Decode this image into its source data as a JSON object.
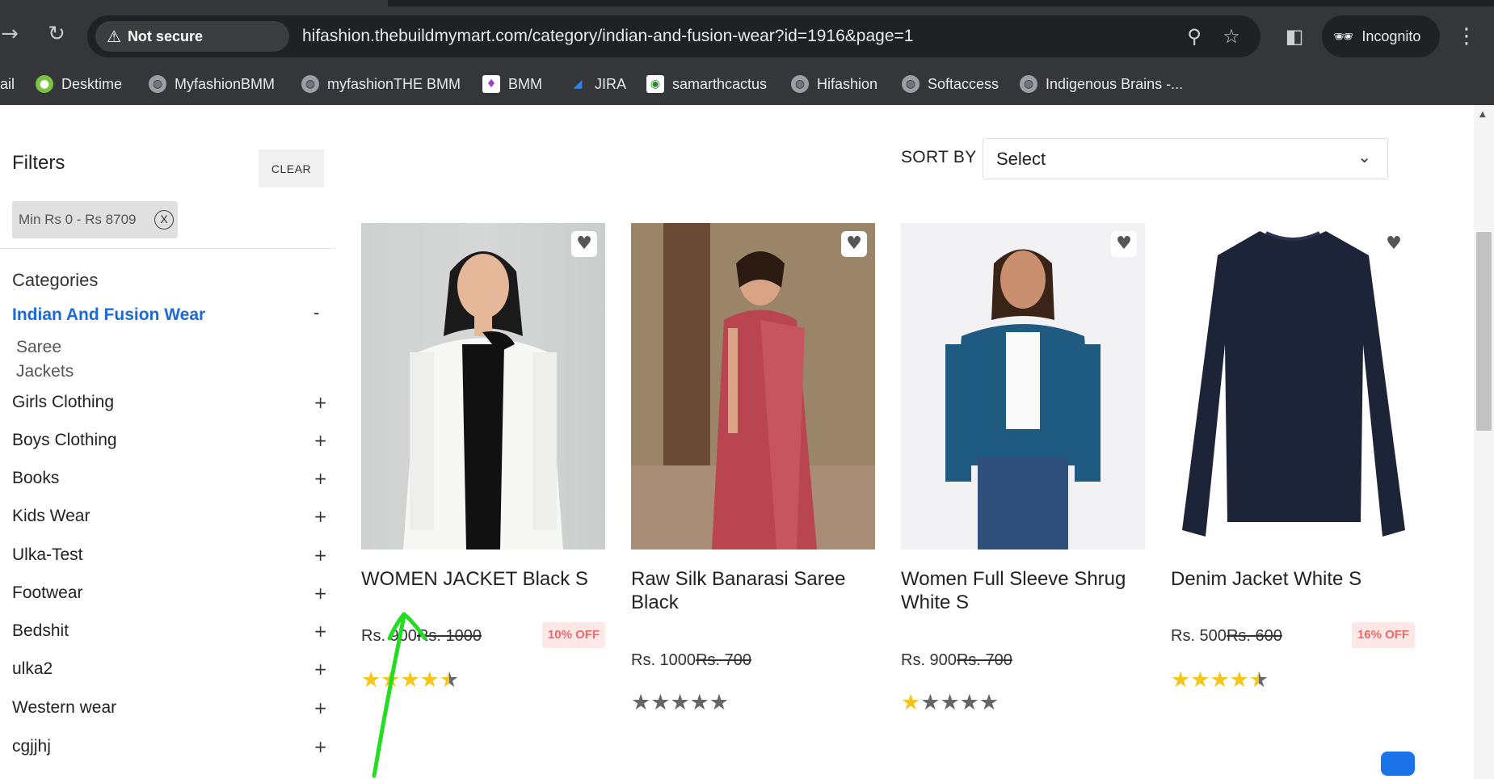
{
  "browser": {
    "security_label": "Not secure",
    "url": "hifashion.thebuildmymart.com/category/indian-and-fusion-wear?id=1916&page=1",
    "profile_label": "Incognito",
    "bookmarks": [
      {
        "label": "ail"
      },
      {
        "label": "Desktime"
      },
      {
        "label": "MyfashionBMM"
      },
      {
        "label": "myfashionTHE BMM"
      },
      {
        "label": "BMM"
      },
      {
        "label": "JIRA"
      },
      {
        "label": "samarthcactus"
      },
      {
        "label": "Hifashion"
      },
      {
        "label": "Softaccess"
      },
      {
        "label": "Indigenous Brains -..."
      }
    ]
  },
  "filters": {
    "title": "Filters",
    "clear_label": "CLEAR",
    "active_chip": "Min Rs 0 - Rs 8709",
    "chip_close": "X"
  },
  "categories": {
    "heading": "Categories",
    "active": {
      "label": "Indian And Fusion Wear",
      "toggle": "-"
    },
    "subcategories": [
      "Saree",
      "Jackets"
    ],
    "others": [
      {
        "label": "Girls Clothing",
        "toggle": "+"
      },
      {
        "label": "Boys Clothing",
        "toggle": "+"
      },
      {
        "label": "Books",
        "toggle": "+"
      },
      {
        "label": "Kids Wear",
        "toggle": "+"
      },
      {
        "label": "Ulka-Test",
        "toggle": "+"
      },
      {
        "label": "Footwear",
        "toggle": "+"
      },
      {
        "label": "Bedshit",
        "toggle": "+"
      },
      {
        "label": "ulka2",
        "toggle": "+"
      },
      {
        "label": "Western wear",
        "toggle": "+"
      },
      {
        "label": "cgjjhj",
        "toggle": "+"
      }
    ]
  },
  "sort": {
    "label": "SORT BY",
    "selected": "Select"
  },
  "products": [
    {
      "name": "WOMEN JACKET Black S",
      "price": "Rs. 900",
      "old_price": "Rs. 1000",
      "discount": "10% OFF",
      "rating": 4.5
    },
    {
      "name": "Raw Silk Banarasi Saree Black",
      "price": "Rs. 1000",
      "old_price": "Rs. 700",
      "discount": "",
      "rating": 0
    },
    {
      "name": "Women Full Sleeve Shrug White S",
      "price": "Rs. 900",
      "old_price": "Rs. 700",
      "discount": "",
      "rating": 1
    },
    {
      "name": "Denim Jacket White S",
      "price": "Rs. 500",
      "old_price": "Rs. 600",
      "discount": "16% OFF",
      "rating": 4.5
    }
  ],
  "colors": {
    "accent_blue": "#1b6bd6",
    "star": "#f5c518",
    "discount_text": "#ef6a6a",
    "annotation_arrow": "#22dd22"
  }
}
